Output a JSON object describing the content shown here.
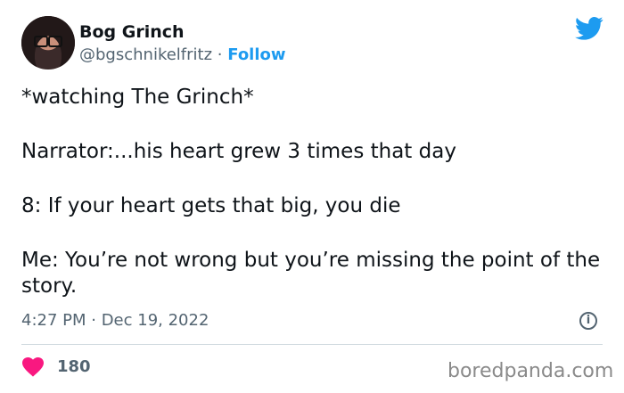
{
  "author": {
    "name": "Bog Grinch",
    "handle": "@bgschnikelfritz",
    "separator": "·",
    "follow_label": "Follow"
  },
  "tweet": {
    "lines": [
      "*watching The Grinch*",
      "Narrator:...his heart grew 3 times that day",
      "8: If your heart gets that big, you die",
      "Me: You’re not wrong but you’re missing the point of the story."
    ],
    "timestamp": "4:27 PM · Dec 19, 2022",
    "info_icon": "i"
  },
  "engagement": {
    "likes": "180"
  },
  "watermark": "boredpanda.com",
  "colors": {
    "accent": "#1d9bf0",
    "heart": "#f91880",
    "secondary_text": "#536471"
  }
}
